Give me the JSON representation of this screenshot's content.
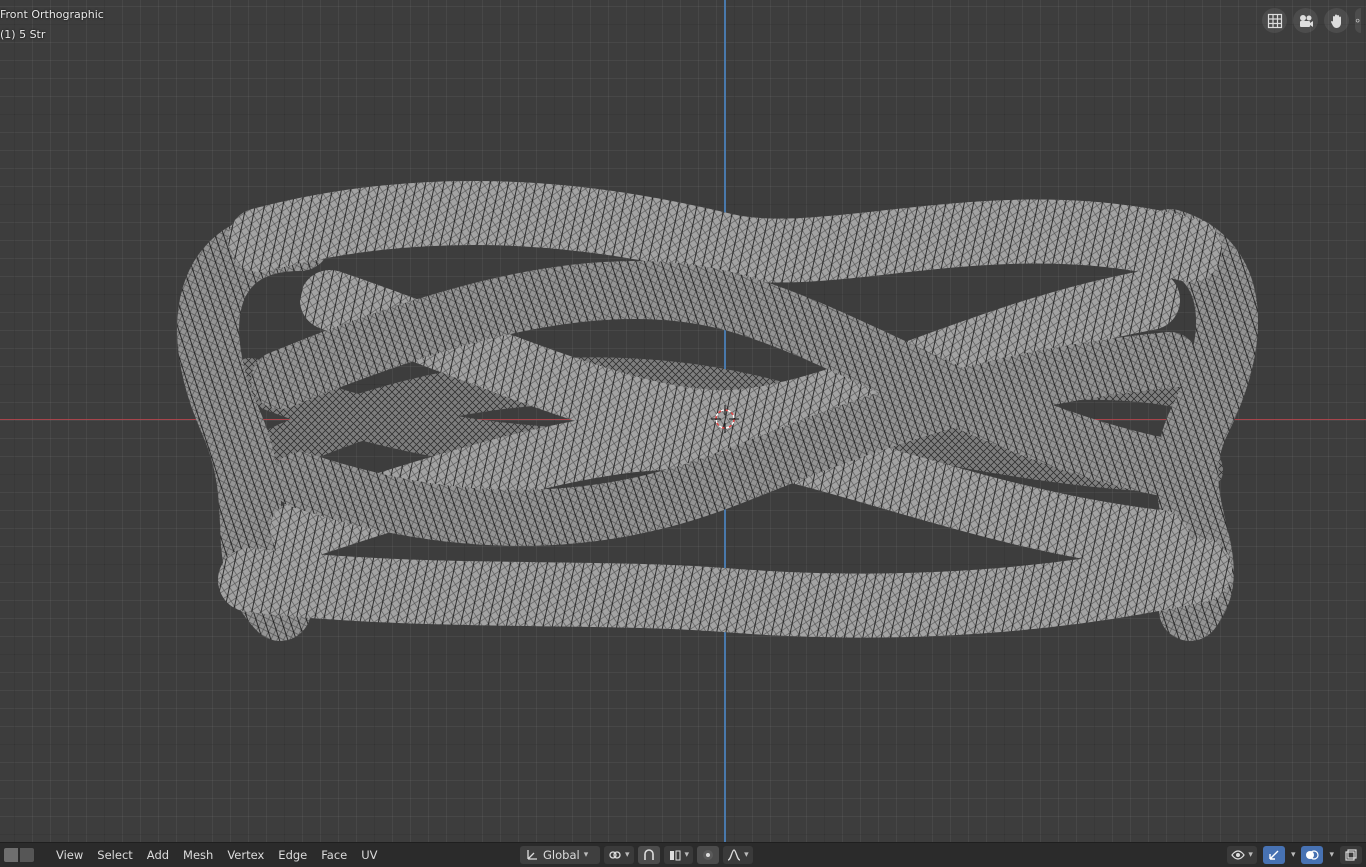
{
  "viewport": {
    "view_name": "Front Orthographic",
    "object_info": "(1) 5 Str",
    "axis_colors": {
      "x": "#b8454d",
      "z": "#4a7fb8"
    },
    "mesh_color": "#9d9d9d",
    "wire_color": "#151515"
  },
  "nav_gizmos": [
    {
      "name": "grid-view-icon"
    },
    {
      "name": "camera-icon"
    },
    {
      "name": "hand-pan-icon"
    },
    {
      "name": "zoom-icon"
    }
  ],
  "header": {
    "menus": [
      "View",
      "Select",
      "Add",
      "Mesh",
      "Vertex",
      "Edge",
      "Face",
      "UV"
    ],
    "orientation": "Global",
    "icons": [
      "transform-orientation-icon",
      "pivot-link-icon",
      "snap-icon",
      "snap-target-icon",
      "proportional-edit-icon",
      "falloff-icon",
      "visibility-icon",
      "gizmo-icon",
      "overlay-icon",
      "xray-icon"
    ]
  }
}
